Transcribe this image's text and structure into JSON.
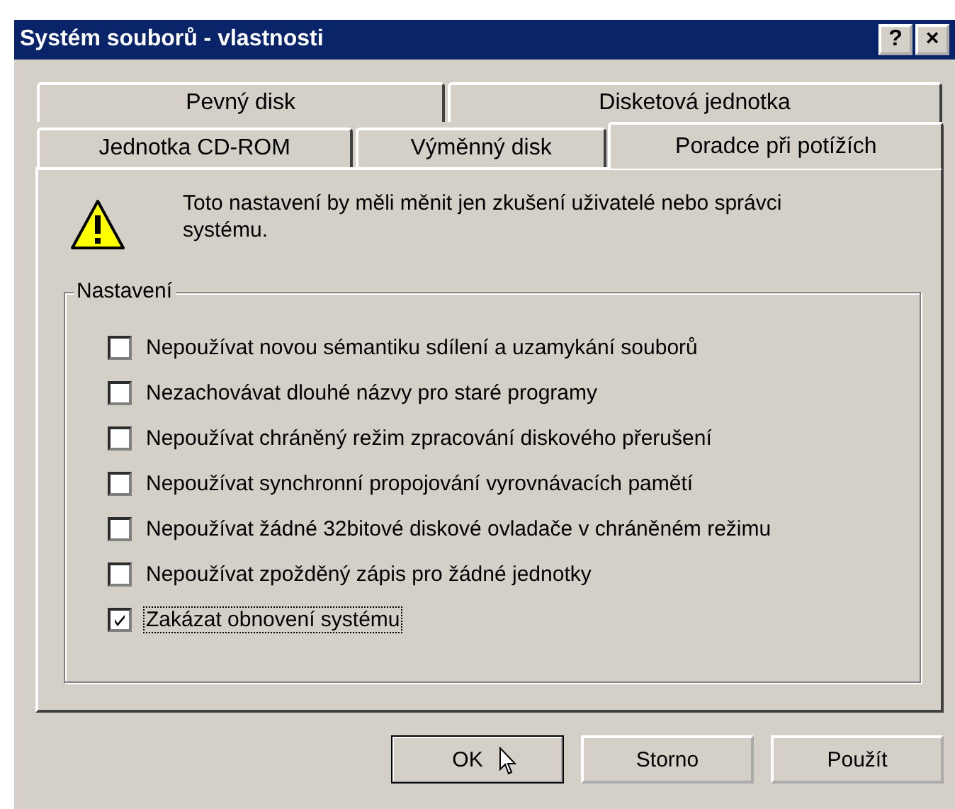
{
  "window": {
    "title": "Systém souborů - vlastnosti",
    "controls": [
      "?",
      "×"
    ]
  },
  "tab_rows": [
    [
      {
        "label": "Pevný disk",
        "selected": false
      },
      {
        "label": "Disketová jednotka",
        "selected": false
      }
    ],
    [
      {
        "label": "Jednotka CD-ROM",
        "selected": false
      },
      {
        "label": "Výměnný disk",
        "selected": false
      },
      {
        "label": "Poradce při potížích",
        "selected": true
      }
    ]
  ],
  "warning": {
    "text": "Toto nastavení by měli měnit jen zkušení uživatelé nebo správci systému."
  },
  "group": {
    "title": "Nastavení",
    "options": [
      {
        "label": "Nepoužívat novou sémantiku sdílení a uzamykání souborů",
        "checked": false,
        "focused": false
      },
      {
        "label": "Nezachovávat dlouhé názvy pro staré programy",
        "checked": false,
        "focused": false
      },
      {
        "label": "Nepoužívat chráněný režim zpracování diskového přerušení",
        "checked": false,
        "focused": false
      },
      {
        "label": "Nepoužívat synchronní propojování vyrovnávacích pamětí",
        "checked": false,
        "focused": false
      },
      {
        "label": "Nepoužívat žádné 32bitové diskové ovladače v chráněném režimu",
        "checked": false,
        "focused": false
      },
      {
        "label": "Nepoužívat zpožděný zápis pro žádné jednotky",
        "checked": false,
        "focused": false
      },
      {
        "label": "Zakázat obnovení systému",
        "checked": true,
        "focused": true
      }
    ]
  },
  "buttons": [
    {
      "label": "OK",
      "default": true
    },
    {
      "label": "Storno",
      "default": false
    },
    {
      "label": "Použít",
      "default": false
    }
  ]
}
